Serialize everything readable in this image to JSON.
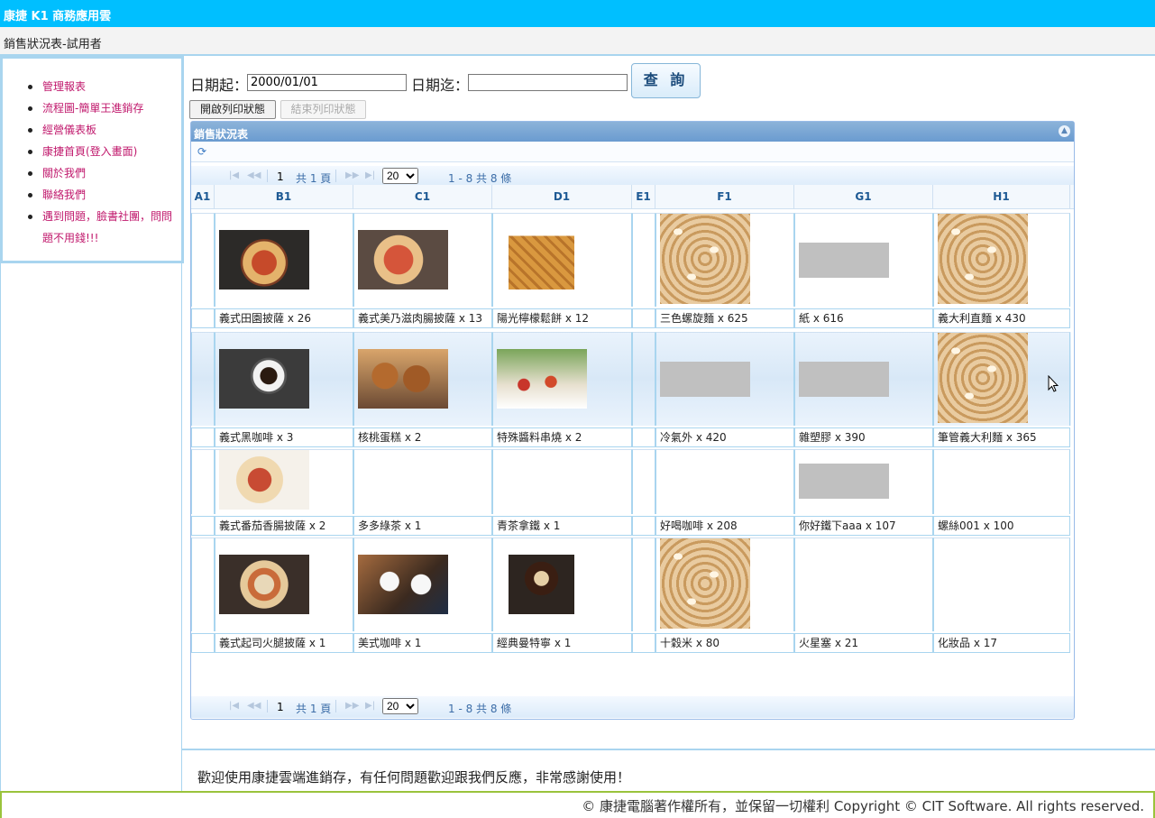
{
  "header": {
    "app_title": "康捷 K1 商務應用雲"
  },
  "subheader": {
    "page_title": "銷售狀況表-試用者"
  },
  "sidebar": {
    "items": [
      {
        "label": "管理報表"
      },
      {
        "label": "流程圖-簡單王進銷存"
      },
      {
        "label": "經營儀表板"
      },
      {
        "label": "康捷首頁(登入畫面)"
      },
      {
        "label": "關於我們"
      },
      {
        "label": "聯絡我們"
      },
      {
        "label": "遇到問題，臉書社團，問問題不用錢!!!"
      }
    ]
  },
  "filter": {
    "date_from_label": "日期起：",
    "date_from_value": "2000/01/01",
    "date_to_label": "日期迄：",
    "date_to_value": "",
    "query_label": "查 詢",
    "print_on_label": "開啟列印狀態",
    "print_off_label": "結束列印狀態"
  },
  "grid": {
    "title": "銷售狀況表",
    "page_input": "1",
    "page_total": "共 1 頁",
    "page_size": "20",
    "record_info": "1 - 8 共 8 條",
    "columns": [
      "A1",
      "B1",
      "C1",
      "D1",
      "E1",
      "F1",
      "G1",
      "H1"
    ],
    "rows": [
      {
        "cells": [
          {
            "col": "B1",
            "label": "義式田園披薩 x 26",
            "img": "pizza"
          },
          {
            "col": "C1",
            "label": "義式美乃滋肉腸披薩 x 13",
            "img": "pizza2"
          },
          {
            "col": "D1",
            "label": "陽光檸檬鬆餅 x 12",
            "img": "waffle"
          },
          {
            "col": "F1",
            "label": "三色螺旋麵 x 625",
            "img": "sesame"
          },
          {
            "col": "G1",
            "label": "紙 x 616",
            "img": "grey"
          },
          {
            "col": "H1",
            "label": "義大利直麵 x 430",
            "img": "sesame"
          }
        ]
      },
      {
        "cells": [
          {
            "col": "B1",
            "label": "義式黑咖啡 x 3",
            "img": "coffee"
          },
          {
            "col": "C1",
            "label": "核桃蛋糕 x 2",
            "img": "muffin"
          },
          {
            "col": "D1",
            "label": "特殊醬料串燒 x 2",
            "img": "kebab"
          },
          {
            "col": "F1",
            "label": "冷氣外 x 420",
            "img": "grey"
          },
          {
            "col": "G1",
            "label": "雜塑膠 x 390",
            "img": "grey"
          },
          {
            "col": "H1",
            "label": "筆管義大利麵 x 365",
            "img": "sesame"
          }
        ]
      },
      {
        "cells": [
          {
            "col": "B1",
            "label": "義式番茄香腸披薩 x 2",
            "img": "pizza3"
          },
          {
            "col": "C1",
            "label": "多多綠茶 x 1",
            "img": ""
          },
          {
            "col": "D1",
            "label": "青茶拿鐵 x 1",
            "img": ""
          },
          {
            "col": "F1",
            "label": "好喝咖啡 x 208",
            "img": ""
          },
          {
            "col": "G1",
            "label": "你好鐵下aaa x 107",
            "img": "grey"
          },
          {
            "col": "H1",
            "label": "螺絲001 x 100",
            "img": ""
          }
        ]
      },
      {
        "cells": [
          {
            "col": "B1",
            "label": "義式起司火腿披薩 x 1",
            "img": "pizza4"
          },
          {
            "col": "C1",
            "label": "美式咖啡 x 1",
            "img": "coffee2"
          },
          {
            "col": "D1",
            "label": "經典曼特寧 x 1",
            "img": "latte"
          },
          {
            "col": "F1",
            "label": "十穀米 x 80",
            "img": "sesame"
          },
          {
            "col": "G1",
            "label": "火星塞 x 21",
            "img": ""
          },
          {
            "col": "H1",
            "label": "化妝品 x 17",
            "img": ""
          }
        ]
      }
    ]
  },
  "footer": {
    "welcome": "歡迎使用康捷雲端進銷存，有任何問題歡迎跟我們反應，非常感謝使用！",
    "copyright": "© 康捷電腦著作權所有，並保留一切權利 Copyright © CIT Software. All rights reserved."
  }
}
